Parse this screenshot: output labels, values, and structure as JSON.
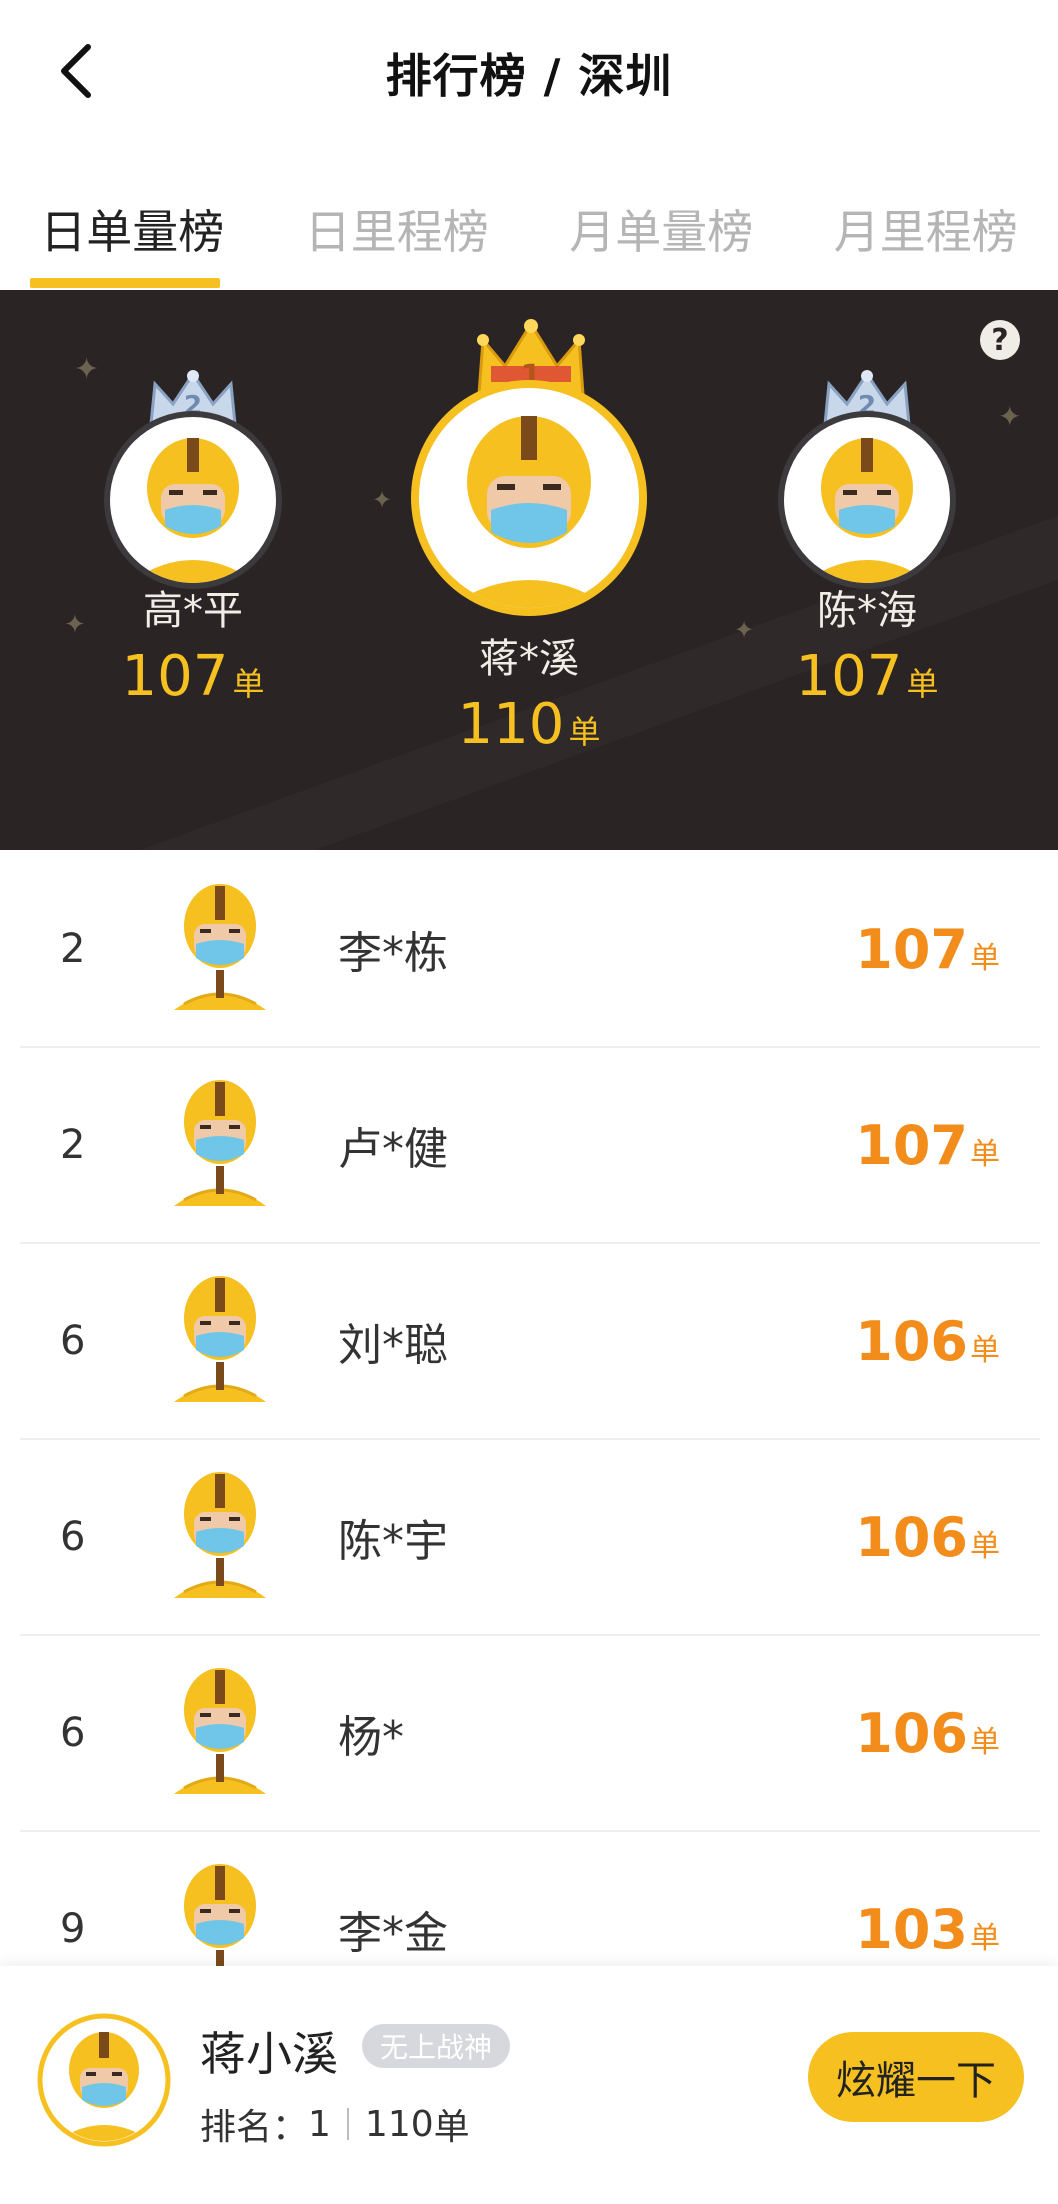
{
  "header": {
    "title": "排行榜 / 深圳"
  },
  "tabs": [
    {
      "label": "日单量榜",
      "active": true
    },
    {
      "label": "日里程榜",
      "active": false
    },
    {
      "label": "月单量榜",
      "active": false
    },
    {
      "label": "月里程榜",
      "active": false
    }
  ],
  "podium": {
    "help_icon": "question-icon",
    "first": {
      "crown": "1",
      "name": "蒋*溪",
      "count": "110",
      "unit": "单"
    },
    "left": {
      "crown": "2",
      "name": "高*平",
      "count": "107",
      "unit": "单"
    },
    "right": {
      "crown": "2",
      "name": "陈*海",
      "count": "107",
      "unit": "单"
    }
  },
  "list": [
    {
      "rank": "2",
      "name": "李*栋",
      "count": "107",
      "unit": "单"
    },
    {
      "rank": "2",
      "name": "卢*健",
      "count": "107",
      "unit": "单"
    },
    {
      "rank": "6",
      "name": "刘*聪",
      "count": "106",
      "unit": "单"
    },
    {
      "rank": "6",
      "name": "陈*宇",
      "count": "106",
      "unit": "单"
    },
    {
      "rank": "6",
      "name": "杨*",
      "count": "106",
      "unit": "单"
    },
    {
      "rank": "9",
      "name": "李*金",
      "count": "103",
      "unit": "单"
    }
  ],
  "me": {
    "name": "蒋小溪",
    "badge": "无上战神",
    "rank_label": "排名：",
    "rank_value": "1",
    "count": "110",
    "unit": "单",
    "show_button": "炫耀一下"
  },
  "colors": {
    "accent": "#f5c020",
    "count_orange": "#f28c1b",
    "podium_bg": "#2a2425"
  }
}
